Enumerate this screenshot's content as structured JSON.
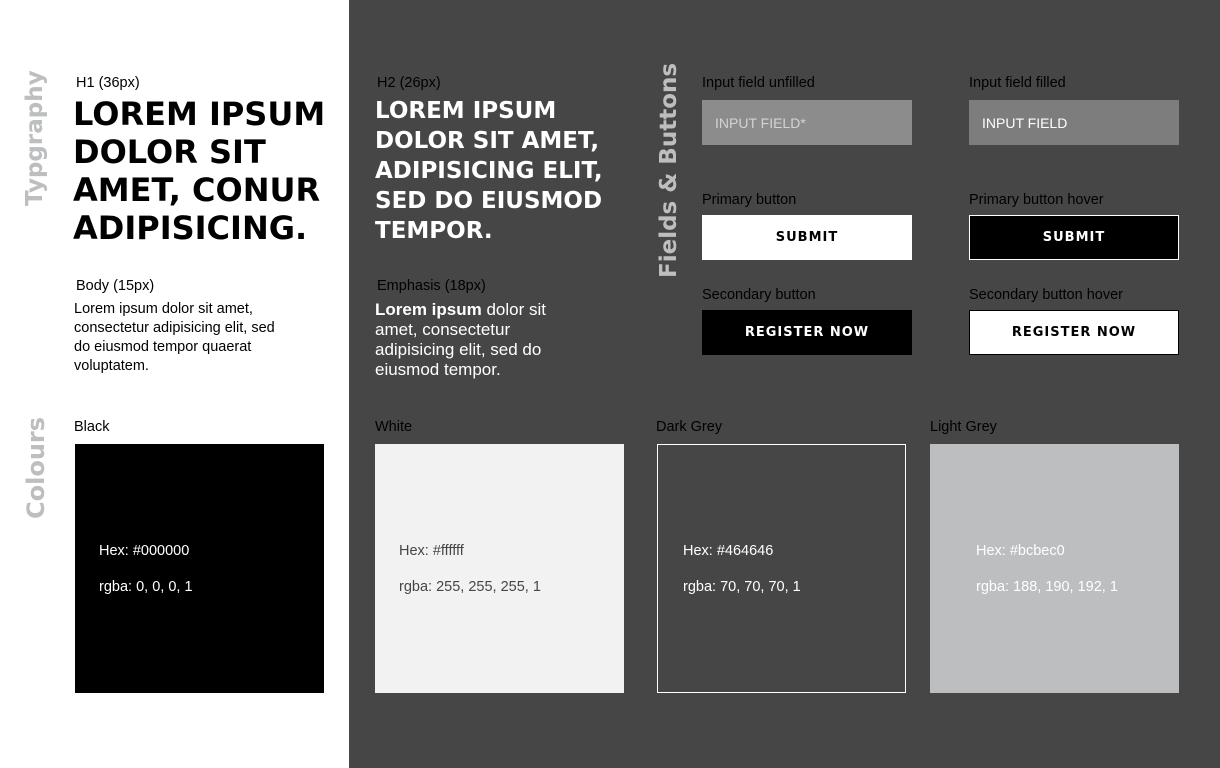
{
  "sections": {
    "typography": "Typgraphy",
    "fields_buttons": "Fields & Buttons",
    "colours": "Colours"
  },
  "typography": {
    "h1_label": "H1 (36px)",
    "h1_text": "LOREM IPSUM DOLOR SIT AMET, CONUR ADIPISICING.",
    "h2_label": "H2 (26px)",
    "h2_text": "LOREM IPSUM DOLOR SIT AMET, ADIPISICING ELIT, SED DO EIUSMOD TEMPOR.",
    "body_label": "Body (15px)",
    "body_text": "Lorem ipsum dolor sit amet, consectetur adipisicing elit, sed do eiusmod tempor quaerat voluptatem.",
    "emphasis_label": "Emphasis (18px)",
    "emphasis_bold": "Lorem ipsum",
    "emphasis_rest": " dolor sit amet, consectetur adipisicing elit, sed do eiusmod tempor."
  },
  "fields": {
    "unfilled_label": "Input field unfilled",
    "unfilled_placeholder": "INPUT FIELD*",
    "filled_label": "Input field filled",
    "filled_value": "INPUT FIELD",
    "primary_label": "Primary button",
    "primary_text": "SUBMIT",
    "primary_hover_label": "Primary button hover",
    "primary_hover_text": "SUBMIT",
    "secondary_label": "Secondary button",
    "secondary_text": "REGISTER NOW",
    "secondary_hover_label": "Secondary button hover",
    "secondary_hover_text": "REGISTER NOW"
  },
  "colours": [
    {
      "name": "Black",
      "hex": "Hex: #000000",
      "rgba": "rgba: 0, 0, 0, 1",
      "fill": "#000000",
      "text_color": "#ffffff"
    },
    {
      "name": "White",
      "hex": "Hex: #ffffff",
      "rgba": "rgba: 255, 255, 255, 1",
      "fill": "#f2f2f2",
      "text_color": "#464646"
    },
    {
      "name": "Dark Grey",
      "hex": "Hex: #464646",
      "rgba": "rgba: 70, 70, 70, 1",
      "fill": "#464646",
      "text_color": "#ffffff"
    },
    {
      "name": "Light Grey",
      "hex": "Hex: #bcbec0",
      "rgba": "rgba: 188, 190, 192, 1",
      "fill": "#bcbec0",
      "text_color": "#ffffff"
    }
  ]
}
